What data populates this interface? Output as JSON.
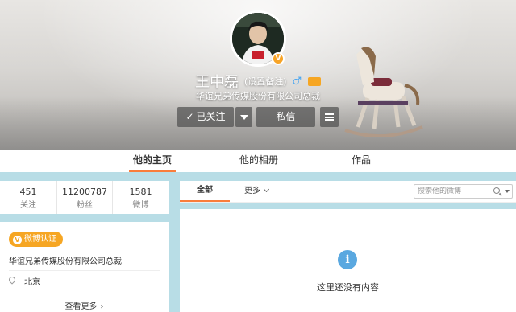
{
  "profile": {
    "name": "王中磊",
    "remark_link": "(设置备注)",
    "gender_symbol": "♂",
    "verified_symbol": "V",
    "bio": "华谊兄弟传媒股份有限公司总裁",
    "follow_button": "已关注",
    "follow_check": "✓",
    "message_button": "私信"
  },
  "tabs": [
    {
      "label": "他的主页",
      "active": true
    },
    {
      "label": "他的相册",
      "active": false
    },
    {
      "label": "作品",
      "active": false
    }
  ],
  "stats": [
    {
      "value": "451",
      "label": "关注"
    },
    {
      "value": "11200787",
      "label": "粉丝"
    },
    {
      "value": "1581",
      "label": "微博"
    }
  ],
  "info_card": {
    "badge": "微博认证",
    "badge_icon": "V",
    "company": "华谊兄弟传媒股份有限公司总裁",
    "location": "北京",
    "more_link": "查看更多",
    "more_chevron": "›"
  },
  "feed": {
    "filter_all": "全部",
    "filter_more": "更多",
    "search_placeholder": "搜索他的微博",
    "empty_message": "这里还没有内容",
    "empty_icon": "i"
  },
  "colors": {
    "page_background": "#b8dde6",
    "accent": "#fa7d3c",
    "verified": "#f6a623",
    "info_icon": "#5aa8e0"
  },
  "icons": [
    "verified-badge-icon",
    "gender-male-icon",
    "vip-icon",
    "check-icon",
    "dropdown-arrow-icon",
    "menu-icon",
    "location-icon",
    "search-icon",
    "info-icon",
    "chevron-right-icon"
  ]
}
